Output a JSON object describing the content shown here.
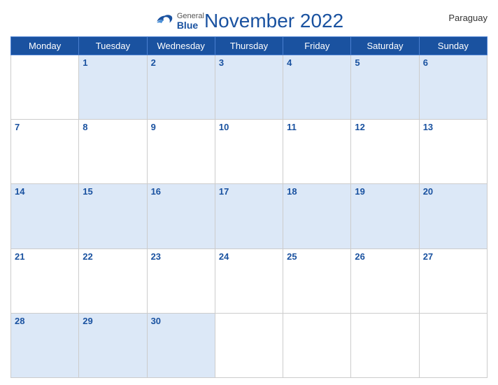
{
  "header": {
    "title": "November 2022",
    "country": "Paraguay",
    "logo_general": "General",
    "logo_blue": "Blue"
  },
  "days_of_week": [
    "Monday",
    "Tuesday",
    "Wednesday",
    "Thursday",
    "Friday",
    "Saturday",
    "Sunday"
  ],
  "weeks": [
    [
      null,
      1,
      2,
      3,
      4,
      5,
      6
    ],
    [
      7,
      8,
      9,
      10,
      11,
      12,
      13
    ],
    [
      14,
      15,
      16,
      17,
      18,
      19,
      20
    ],
    [
      21,
      22,
      23,
      24,
      25,
      26,
      27
    ],
    [
      28,
      29,
      30,
      null,
      null,
      null,
      null
    ]
  ]
}
